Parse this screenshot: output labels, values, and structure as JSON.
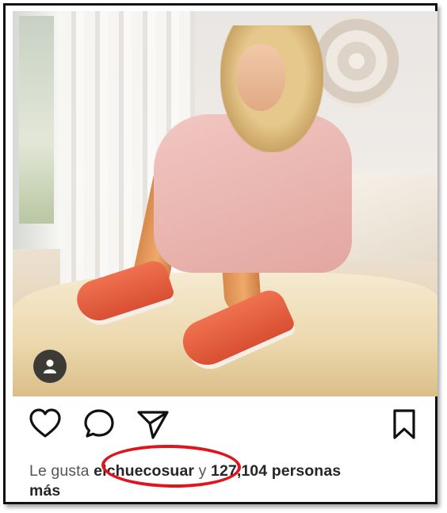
{
  "post": {
    "image_alt": "",
    "actions": {
      "like_icon": "heart-icon",
      "comment_icon": "comment-bubble-icon",
      "share_icon": "paper-plane-icon",
      "save_icon": "bookmark-icon",
      "tag_icon": "user-tag-icon"
    },
    "likes": {
      "prefix": "Le gusta",
      "username": "elchuecosuar",
      "middle": "y",
      "count": "127,104 personas",
      "suffix": "más"
    }
  },
  "colors": {
    "highlight_circle": "#e0141c",
    "text": "#262626",
    "border": "#111111"
  }
}
